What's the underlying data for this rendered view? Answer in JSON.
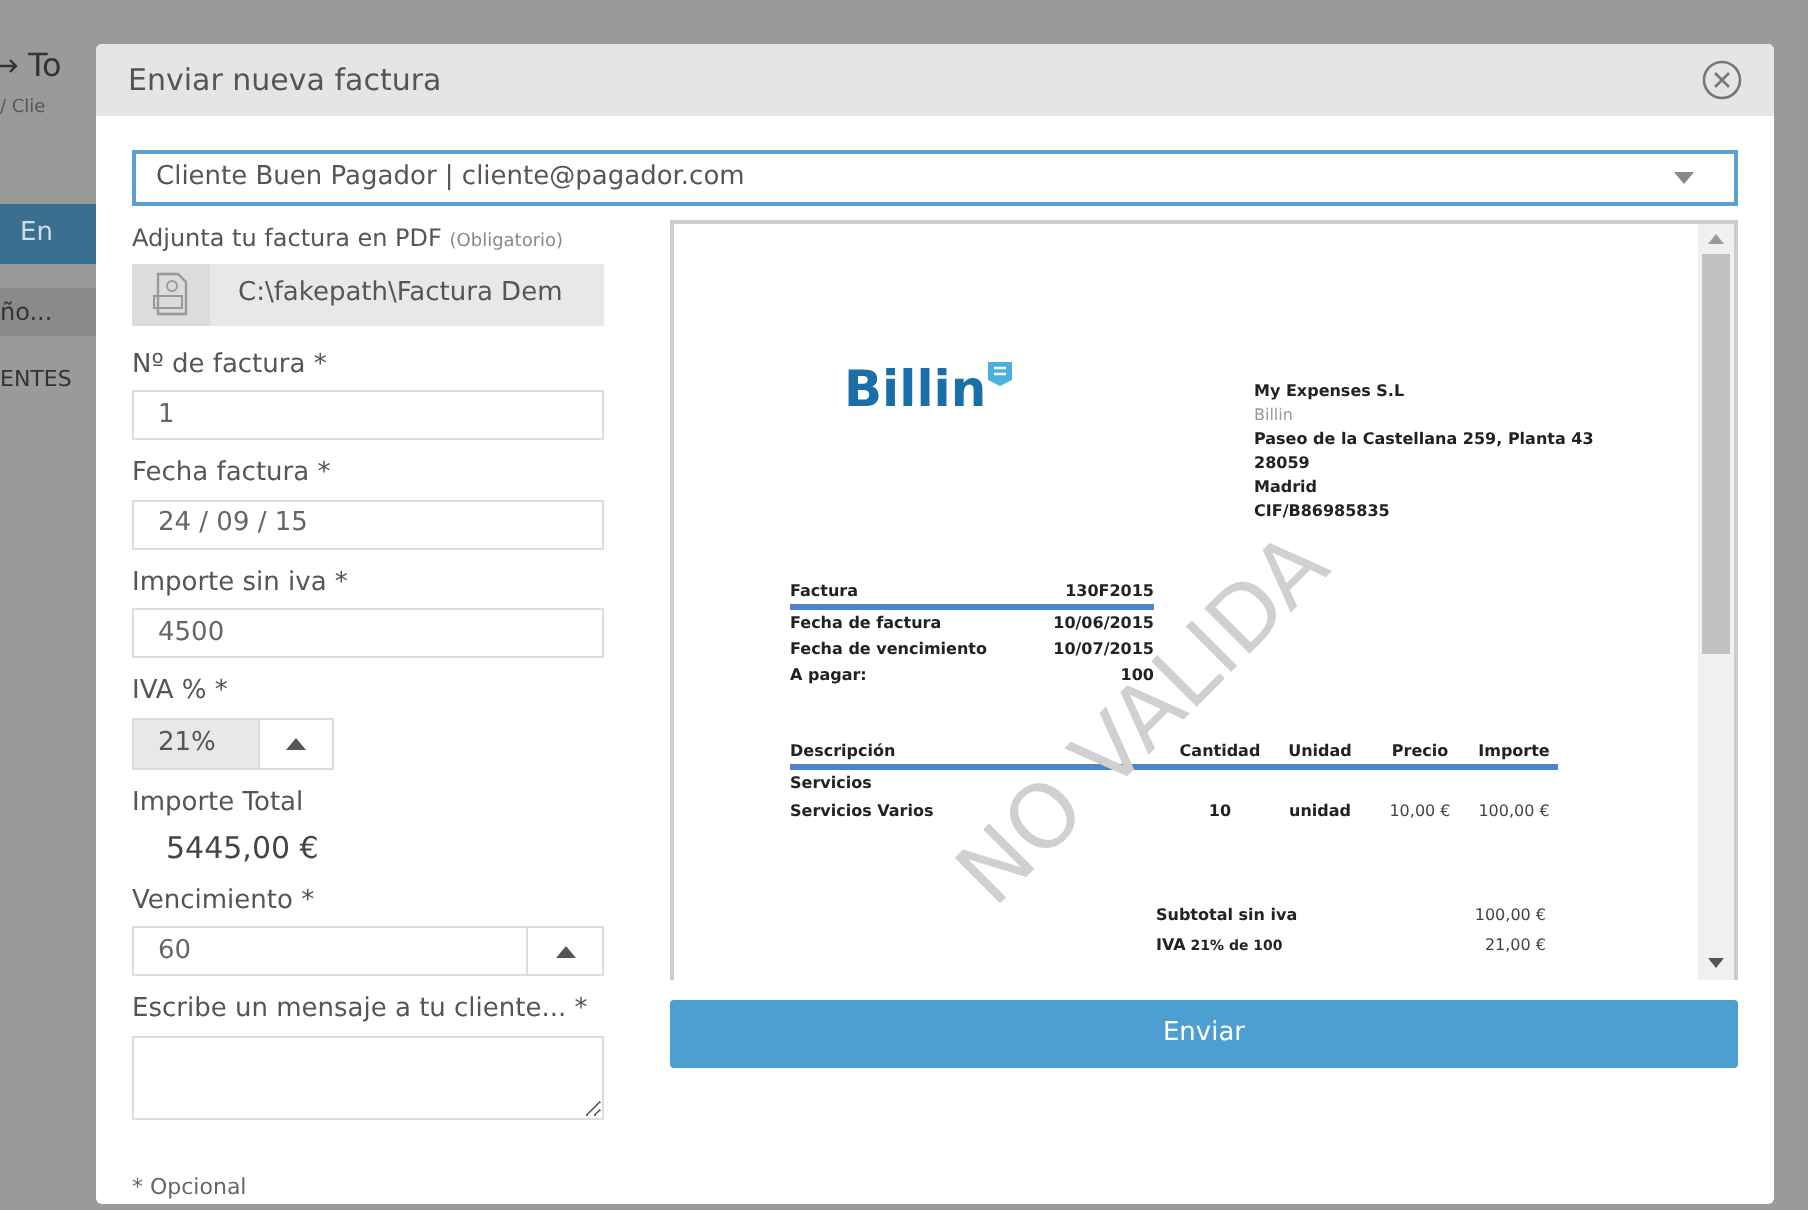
{
  "background": {
    "title_fragment": "To",
    "breadcrumb_fragment": "/ Clie",
    "button_fragment": "En",
    "field_fragment": "ño...",
    "column_fragment": "ENTES"
  },
  "dialog": {
    "title": "Enviar nueva factura",
    "client_select": {
      "value": "Cliente Buen Pagador | cliente@pagador.com"
    },
    "attachment": {
      "label": "Adjunta tu factura en PDF",
      "note": "(Obligatorio)",
      "value": "C:\\fakepath\\Factura Dem"
    },
    "fields": [
      {
        "kind": "input",
        "label": "Nº de factura *",
        "value": "1"
      },
      {
        "kind": "input",
        "label": "Fecha factura *",
        "value": "24 / 09 / 15"
      },
      {
        "kind": "input",
        "label": "Importe sin iva *",
        "value": "4500"
      },
      {
        "kind": "stepper_short",
        "label": "IVA % *",
        "value": "21%"
      },
      {
        "kind": "total",
        "label": "Importe Total",
        "value": "5445,00 €"
      },
      {
        "kind": "stepper",
        "label": "Vencimiento *",
        "value": "60"
      },
      {
        "kind": "textarea",
        "label": "Escribe un mensaje a tu cliente... *"
      }
    ],
    "footnote": "* Opcional",
    "submit": "Enviar"
  },
  "preview": {
    "watermark": "NO VALIDA",
    "logo": "Billin",
    "company": [
      "My Expenses S.L",
      "Billin",
      "Paseo de la Castellana 259, Planta 43",
      "28059",
      "Madrid",
      "CIF/B86985835"
    ],
    "summary": [
      [
        "Factura",
        "130F2015"
      ],
      [
        "Fecha de factura",
        "10/06/2015"
      ],
      [
        "Fecha de vencimiento",
        "10/07/2015"
      ],
      [
        "A pagar:",
        "100"
      ]
    ],
    "columns": [
      "Descripción",
      "Cantidad",
      "Unidad",
      "Precio",
      "Importe"
    ],
    "section": "Servicios",
    "rows": [
      [
        "Servicios Varios",
        "10",
        "unidad",
        "10,00 €",
        "100,00 €"
      ]
    ],
    "totals": [
      {
        "label": "Subtotal sin iva",
        "value": "100,00 €"
      },
      {
        "label": "IVA",
        "detail": "21% de 100",
        "value": "21,00 €"
      }
    ]
  }
}
